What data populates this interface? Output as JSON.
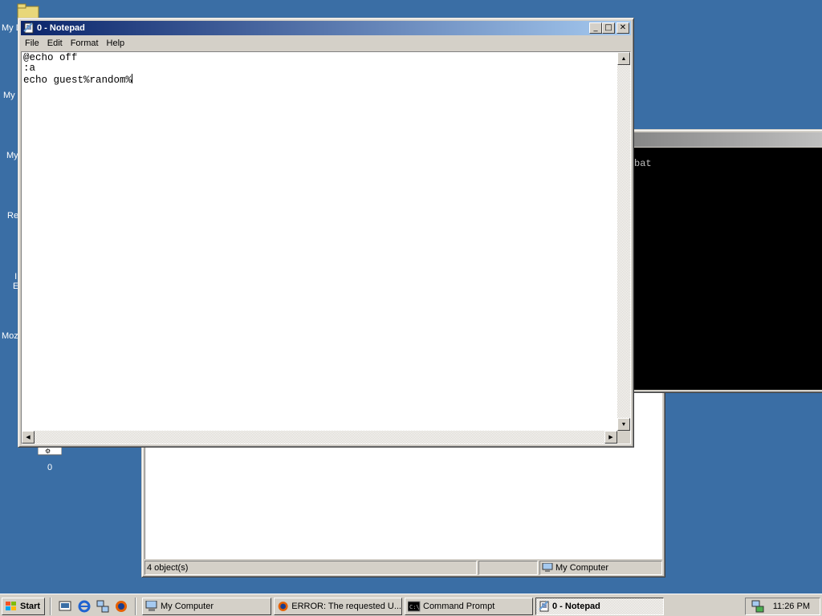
{
  "desktop": {
    "icons": [
      {
        "label": "My D"
      },
      {
        "label": "My"
      },
      {
        "label": "My"
      },
      {
        "label": "Re"
      },
      {
        "label": "I"
      },
      {
        "label": "E"
      },
      {
        "label": "Moz"
      },
      {
        "label": "0"
      }
    ]
  },
  "notepad": {
    "title": "0 - Notepad",
    "menu": [
      "File",
      "Edit",
      "Format",
      "Help"
    ],
    "lines": [
      "@echo off",
      ":a",
      "echo guest%random%"
    ],
    "buttons": {
      "minimize": "_",
      "maximize": "□",
      "close": "✕"
    }
  },
  "cmd": {
    "visible_text": "bat"
  },
  "mycomputer": {
    "status_left": "4 object(s)",
    "status_right": "My Computer"
  },
  "taskbar": {
    "start_label": "Start",
    "tasks": [
      {
        "label": "My Computer",
        "icon": "computer-icon"
      },
      {
        "label": "ERROR: The requested U...",
        "icon": "firefox-icon"
      },
      {
        "label": "Command Prompt",
        "icon": "cmd-icon"
      },
      {
        "label": "0 - Notepad",
        "icon": "notepad-icon"
      }
    ],
    "clock": "11:26 PM"
  },
  "colors": {
    "desktop": "#3a6ea5",
    "title_active": "#0a246a",
    "title_inactive": "#808080",
    "chrome": "#d4d0c8"
  }
}
